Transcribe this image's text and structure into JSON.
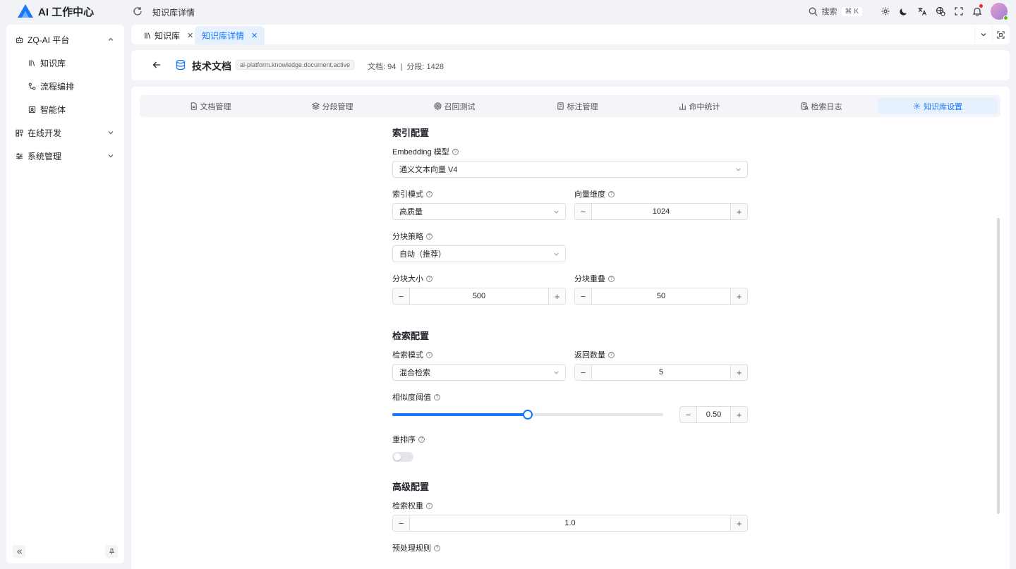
{
  "app": {
    "title": "AI 工作中心",
    "brand_color": "#1677ff"
  },
  "header": {
    "breadcrumb": "知识库详情",
    "search_label": "搜索",
    "search_shortcut": "⌘ K"
  },
  "sidebar": {
    "items": [
      {
        "label": "ZQ-AI 平台",
        "icon": "robot-icon",
        "expanded": true
      },
      {
        "label": "知识库",
        "icon": "library-icon"
      },
      {
        "label": "流程编排",
        "icon": "workflow-icon"
      },
      {
        "label": "智能体",
        "icon": "agent-icon"
      },
      {
        "label": "在线开发",
        "icon": "dev-icon",
        "expanded": false
      },
      {
        "label": "系统管理",
        "icon": "settings-icon",
        "expanded": false
      }
    ]
  },
  "tabs": [
    {
      "label": "知识库",
      "active": false
    },
    {
      "label": "知识库详情",
      "active": true
    }
  ],
  "kb": {
    "title": "技术文档",
    "code": "ai-platform.knowledge.document.active",
    "stats": "文档: 94  |  分段: 1428"
  },
  "subtabs": [
    {
      "label": "文档管理",
      "icon": "file-icon"
    },
    {
      "label": "分段管理",
      "icon": "layers-icon"
    },
    {
      "label": "召回测试",
      "icon": "target-icon"
    },
    {
      "label": "标注管理",
      "icon": "note-icon"
    },
    {
      "label": "命中统计",
      "icon": "bar-chart-icon"
    },
    {
      "label": "检索日志",
      "icon": "log-icon"
    },
    {
      "label": "知识库设置",
      "icon": "gear-icon",
      "active": true
    }
  ],
  "index_config": {
    "title": "索引配置",
    "embedding_label": "Embedding 模型",
    "embedding_value": "通义文本向量 V4",
    "index_mode_label": "索引模式",
    "index_mode_value": "高质量",
    "vector_dim_label": "向量维度",
    "vector_dim_value": "1024",
    "chunk_strategy_label": "分块策略",
    "chunk_strategy_value": "自动（推荐）",
    "chunk_size_label": "分块大小",
    "chunk_size_value": "500",
    "chunk_overlap_label": "分块重叠",
    "chunk_overlap_value": "50"
  },
  "retrieval_config": {
    "title": "检索配置",
    "mode_label": "检索模式",
    "mode_value": "混合检索",
    "topk_label": "返回数量",
    "topk_value": "5",
    "threshold_label": "相似度阈值",
    "threshold_value": "0.50",
    "threshold_fraction": 0.5,
    "rerank_label": "重排序",
    "rerank_enabled": false
  },
  "advanced_config": {
    "title": "高级配置",
    "weight_label": "检索权重",
    "weight_value": "1.0",
    "preprocess_label": "预处理规则"
  }
}
